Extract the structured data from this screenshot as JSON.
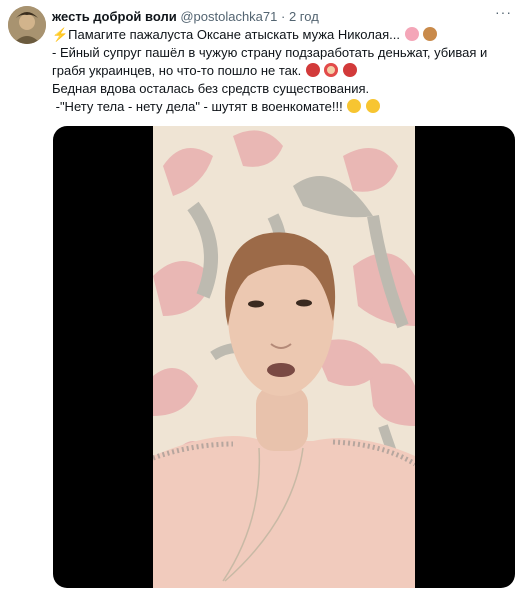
{
  "tweet": {
    "author_name": "жесть доброй воли",
    "author_handle": "@postolachka71",
    "separator": "·",
    "time": "2 год",
    "more_label": "···",
    "lines": [
      "⚡Памагите пажалуста Оксане атыскать мужа Николая...",
      "- Ейный супруг пашёл в чужую страну подзаработать деньжат, убивая и",
      "грабя украинцев, но что-то пошло не так.",
      "Бедная вдова осталась без средств существования.",
      " -\"Нету тела - нету дела\" - шутят в военкомате!!!"
    ]
  },
  "colors": {
    "text": "#0f1419",
    "secondary": "#536471",
    "wall": "#efe4d4",
    "flower": "#e9b7b4",
    "leaf": "#bdbab0",
    "shirt": "#f1cbbd"
  },
  "icons": {
    "lightning": "lightning-emoji",
    "pig": "pig-face-emoji",
    "dog": "dog-face-emoji",
    "angry": "cursing-face-emoji",
    "clown": "clown-face-emoji",
    "grimace": "grimacing-face-emoji"
  }
}
